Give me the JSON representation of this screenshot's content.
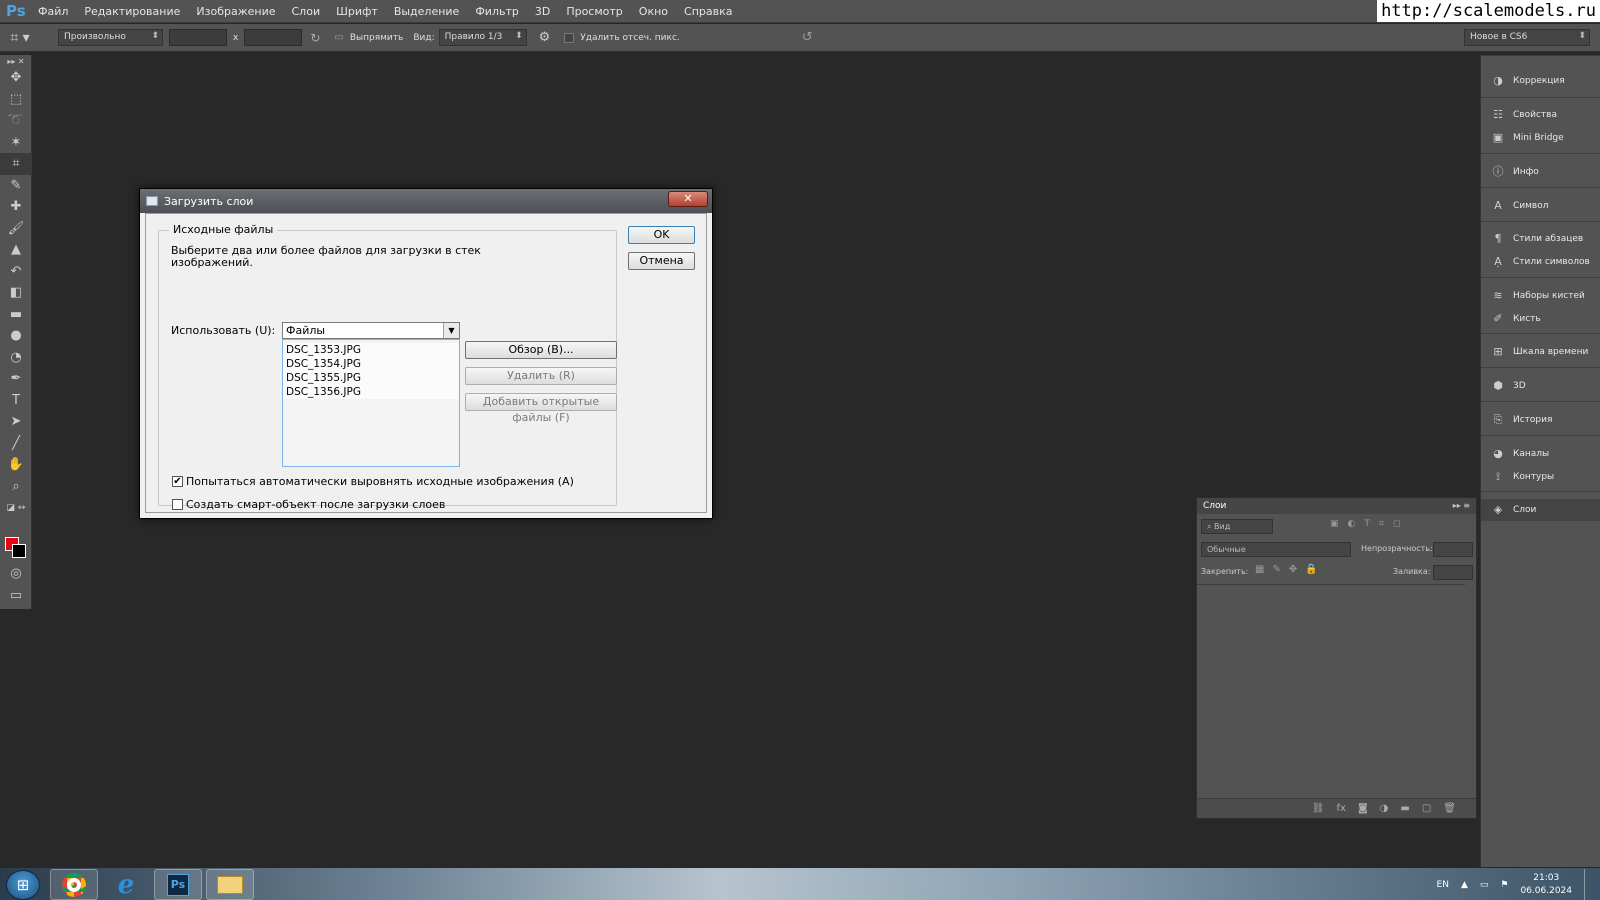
{
  "app": {
    "logo": "Ps"
  },
  "menu": [
    "Файл",
    "Редактирование",
    "Изображение",
    "Слои",
    "Шрифт",
    "Выделение",
    "Фильтр",
    "3D",
    "Просмотр",
    "Окно",
    "Справка"
  ],
  "watermark": "http://scalemodels.ru",
  "options_bar": {
    "ratio_select": "Произвольно",
    "times": "x",
    "straighten": "Выпрямить",
    "view_label": "Вид:",
    "view_select": "Правило 1/3",
    "delete_cropped": "Удалить отсеч. пикс.",
    "workspace": "Новое в CS6"
  },
  "dialog": {
    "title": "Загрузить слои",
    "close": "✕",
    "group_title": "Исходные файлы",
    "description_line1": "Выберите два или более файлов для загрузки в стек",
    "description_line2": "изображений.",
    "use_label": "Использовать (U):",
    "use_value": "Файлы",
    "files": [
      "DSC_1353.JPG",
      "DSC_1354.JPG",
      "DSC_1355.JPG",
      "DSC_1356.JPG"
    ],
    "browse": "Обзор (B)...",
    "remove": "Удалить (R)",
    "add_open": "Добавить открытые файлы (F)",
    "auto_align": "Попытаться автоматически выровнять исходные изображения (A)",
    "auto_align_checked": true,
    "smart_object": "Создать смарт-объект после загрузки слоев",
    "smart_object_checked": false,
    "ok": "OK",
    "cancel": "Отмена"
  },
  "right_dock": [
    {
      "label": "Коррекция",
      "icon": "adjustments-icon"
    },
    {
      "label": "Свойства",
      "icon": "properties-icon"
    },
    {
      "label": "Mini Bridge",
      "icon": "mini-bridge-icon"
    },
    {
      "label": "Инфо",
      "icon": "info-icon"
    },
    {
      "label": "Символ",
      "icon": "character-icon"
    },
    {
      "label": "Стили абзацев",
      "icon": "paragraph-styles-icon"
    },
    {
      "label": "Стили символов",
      "icon": "character-styles-icon"
    },
    {
      "label": "Наборы кистей",
      "icon": "brush-presets-icon"
    },
    {
      "label": "Кисть",
      "icon": "brush-icon"
    },
    {
      "label": "Шкала времени",
      "icon": "timeline-icon"
    },
    {
      "label": "3D",
      "icon": "3d-icon"
    },
    {
      "label": "История",
      "icon": "history-icon"
    },
    {
      "label": "Каналы",
      "icon": "channels-icon"
    },
    {
      "label": "Контуры",
      "icon": "paths-icon"
    },
    {
      "label": "Слои",
      "icon": "layers-icon"
    }
  ],
  "layers_panel": {
    "title": "Слои",
    "filter": "Вид",
    "blend_mode": "Обычные",
    "opacity_label": "Непрозрачность:",
    "lock_label": "Закрепить:",
    "fill_label": "Заливка:"
  },
  "taskbar": {
    "lang": "EN",
    "time": "21:03",
    "date": "06.06.2024"
  }
}
